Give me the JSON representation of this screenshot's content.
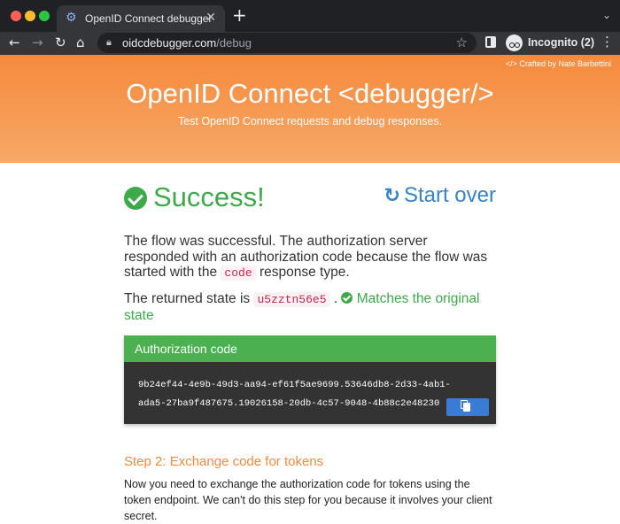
{
  "browser": {
    "tab_title": "OpenID Connect debugger",
    "url_host": "oidcdebugger.com",
    "url_path": "/debug",
    "incognito_label": "Incognito (2)"
  },
  "hero": {
    "crafted_by": "</> Crafted by Nate Barbettini",
    "title": "OpenID Connect <debugger/>",
    "subtitle": "Test OpenID Connect requests and debug responses."
  },
  "result": {
    "success_title": "Success!",
    "start_over_label": "Start over",
    "flow_text_before": "The flow was successful. The authorization server responded with an authorization code because the flow was started with the",
    "response_type": "code",
    "flow_text_after": "response type.",
    "state_prefix": "The returned state is",
    "state_value": "u5zztn56e5",
    "state_separator": ".",
    "state_match": "Matches the original state"
  },
  "auth_code": {
    "header": "Authorization code",
    "line1": "9b24ef44-4e9b-49d3-aa94-ef61f5ae9699.53646db8-2d33-4ab1-",
    "line2": "ada5-27ba9f487675.19026158-20db-4c57-9048-4b88c2e48230"
  },
  "step2": {
    "heading": "Step 2: Exchange code for tokens",
    "body": "Now you need to exchange the authorization code for tokens using the token endpoint. We can't do this step for you because it involves your client secret."
  },
  "colors": {
    "brand_orange": "#f58a3c",
    "success_green": "#3daa4a",
    "link_blue": "#3583c8"
  },
  "icons": [
    "gear-icon",
    "close-icon",
    "plus-icon",
    "back-icon",
    "forward-icon",
    "reload-icon",
    "home-icon",
    "lock-icon",
    "star-icon",
    "side-panel-icon",
    "incognito-icon",
    "menu-icon",
    "check-circle-icon",
    "refresh-icon",
    "copy-icon"
  ]
}
